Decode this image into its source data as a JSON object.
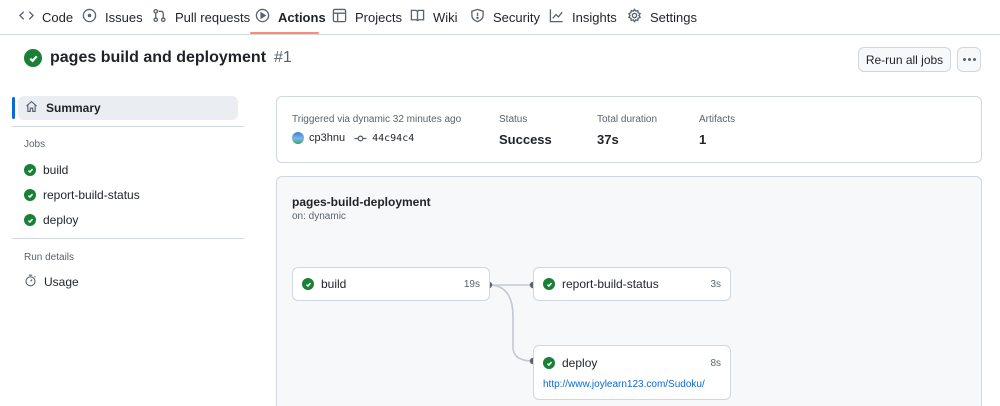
{
  "nav": {
    "items": [
      {
        "label": "Code",
        "icon": "code-icon"
      },
      {
        "label": "Issues",
        "icon": "issue-icon"
      },
      {
        "label": "Pull requests",
        "icon": "pull-request-icon"
      },
      {
        "label": "Actions",
        "icon": "play-icon",
        "active": true
      },
      {
        "label": "Projects",
        "icon": "table-icon"
      },
      {
        "label": "Wiki",
        "icon": "book-icon"
      },
      {
        "label": "Security",
        "icon": "shield-icon"
      },
      {
        "label": "Insights",
        "icon": "graph-icon"
      },
      {
        "label": "Settings",
        "icon": "gear-icon"
      }
    ]
  },
  "run": {
    "title": "pages build and deployment",
    "number": "#1",
    "rerun_label": "Re-run all jobs",
    "status_color": "#1a7f37"
  },
  "sidebar": {
    "summary_label": "Summary",
    "jobs_heading": "Jobs",
    "jobs": [
      "build",
      "report-build-status",
      "deploy"
    ],
    "run_details_heading": "Run details",
    "usage_label": "Usage"
  },
  "summary": {
    "trigger_label": "Triggered via dynamic 32 minutes ago",
    "user": "cp3hnu",
    "commit": "44c94c4",
    "status_label": "Status",
    "status_value": "Success",
    "duration_label": "Total duration",
    "duration_value": "37s",
    "artifacts_label": "Artifacts",
    "artifacts_value": "1"
  },
  "workflow": {
    "name": "pages-build-deployment",
    "on": "on: dynamic",
    "jobs": {
      "build": {
        "label": "build",
        "duration": "19s"
      },
      "report": {
        "label": "report-build-status",
        "duration": "3s"
      },
      "deploy": {
        "label": "deploy",
        "duration": "8s",
        "url": "http://www.joylearn123.com/Sudoku/"
      }
    }
  }
}
